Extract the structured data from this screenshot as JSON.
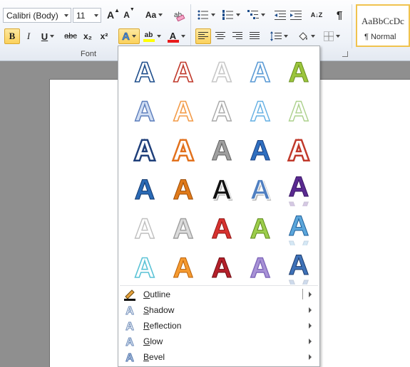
{
  "ribbon": {
    "font_name": "Calibri (Body)",
    "font_size": "11",
    "grow_font_label": "A",
    "shrink_font_label": "A",
    "change_case_label": "Aa",
    "bold_label": "B",
    "italic_label": "I",
    "underline_label": "U",
    "strikethrough_label": "abc",
    "subscript_label": "x₂",
    "superscript_label": "x²",
    "text_effects_label": "A",
    "highlight_label": "ab",
    "font_color_label": "A",
    "sort_label": "A↓Z",
    "pilcrow_label": "¶",
    "font_group_label": "Font",
    "style_preview": "AaBbCcDc",
    "style_name": "¶ Normal"
  },
  "gallery": {
    "effects": [
      {
        "fill": "#ffffff",
        "stroke": "#1f4e8c",
        "style": "outline"
      },
      {
        "fill": "#ffffff",
        "stroke": "#c0392b",
        "style": "outline"
      },
      {
        "fill": "#ffffff",
        "stroke": "#c8c8c8",
        "style": "outline"
      },
      {
        "fill": "#ffffff",
        "stroke": "#5b9bd5",
        "style": "outline"
      },
      {
        "fill": "#9bc53d",
        "stroke": "#6a8f1f",
        "style": "solid"
      },
      {
        "fill": "#c9d9f2",
        "stroke": "#3f66b0",
        "style": "soft"
      },
      {
        "fill": "#ffffff",
        "stroke": "#f39c4a",
        "style": "outline"
      },
      {
        "fill": "#ffffff",
        "stroke": "#9a9a9a",
        "style": "soft"
      },
      {
        "fill": "#ffffff",
        "stroke": "#4aa3df",
        "style": "soft"
      },
      {
        "fill": "#ffffff",
        "stroke": "#9fc97a",
        "style": "soft"
      },
      {
        "fill": "#ffffff",
        "stroke": "#1f3f7a",
        "style": "double"
      },
      {
        "fill": "#ffffff",
        "stroke": "#e2711d",
        "style": "double"
      },
      {
        "fill": "#a0a0a0",
        "stroke": "#606060",
        "style": "solid"
      },
      {
        "fill": "#2f6fc0",
        "stroke": "#1a3f80",
        "style": "solid"
      },
      {
        "fill": "#ffffff",
        "stroke": "#c0392b",
        "style": "double"
      },
      {
        "fill": "#2a6ab5",
        "stroke": "#12386e",
        "style": "solid"
      },
      {
        "fill": "#e07a1a",
        "stroke": "#9c4d08",
        "style": "solid"
      },
      {
        "fill": "#111111",
        "stroke": "#ffffff",
        "style": "shadow"
      },
      {
        "fill": "#4f7fc1",
        "stroke": "#ffffff",
        "style": "shadow"
      },
      {
        "fill": "#5a2a91",
        "stroke": "#3a1765",
        "style": "reflect"
      },
      {
        "fill": "#ffffff",
        "stroke": "#b5b5b5",
        "style": "soft"
      },
      {
        "fill": "#d6d6d6",
        "stroke": "#8f8f8f",
        "style": "soft"
      },
      {
        "fill": "#d7322f",
        "stroke": "#8e1614",
        "style": "solid"
      },
      {
        "fill": "#9ccd4b",
        "stroke": "#5f8a1c",
        "style": "solid"
      },
      {
        "fill": "#5ba6db",
        "stroke": "#1f5f98",
        "style": "reflect"
      },
      {
        "fill": "#ffffff",
        "stroke": "#5cc3d6",
        "style": "outline"
      },
      {
        "fill": "#f59a30",
        "stroke": "#b85f08",
        "style": "solid"
      },
      {
        "fill": "#b5202a",
        "stroke": "#6d0d12",
        "style": "solid"
      },
      {
        "fill": "#9a7fd0",
        "stroke": "#6a4fb0",
        "style": "soft"
      },
      {
        "fill": "#3f72b8",
        "stroke": "#1c3c6e",
        "style": "reflect"
      }
    ],
    "glyph": "A"
  },
  "menu": {
    "items": [
      {
        "label": "Outline",
        "ul": "O",
        "rest": "utline",
        "icon": "outline-icon",
        "split": true
      },
      {
        "label": "Shadow",
        "ul": "S",
        "rest": "hadow",
        "icon": "shadow-icon",
        "split": false
      },
      {
        "label": "Reflection",
        "ul": "R",
        "rest": "eflection",
        "icon": "reflection-icon",
        "split": false
      },
      {
        "label": "Glow",
        "ul": "G",
        "rest": "low",
        "icon": "glow-icon",
        "split": false
      },
      {
        "label": "Bevel",
        "ul": "B",
        "rest": "evel",
        "icon": "bevel-icon",
        "split": false
      }
    ]
  }
}
